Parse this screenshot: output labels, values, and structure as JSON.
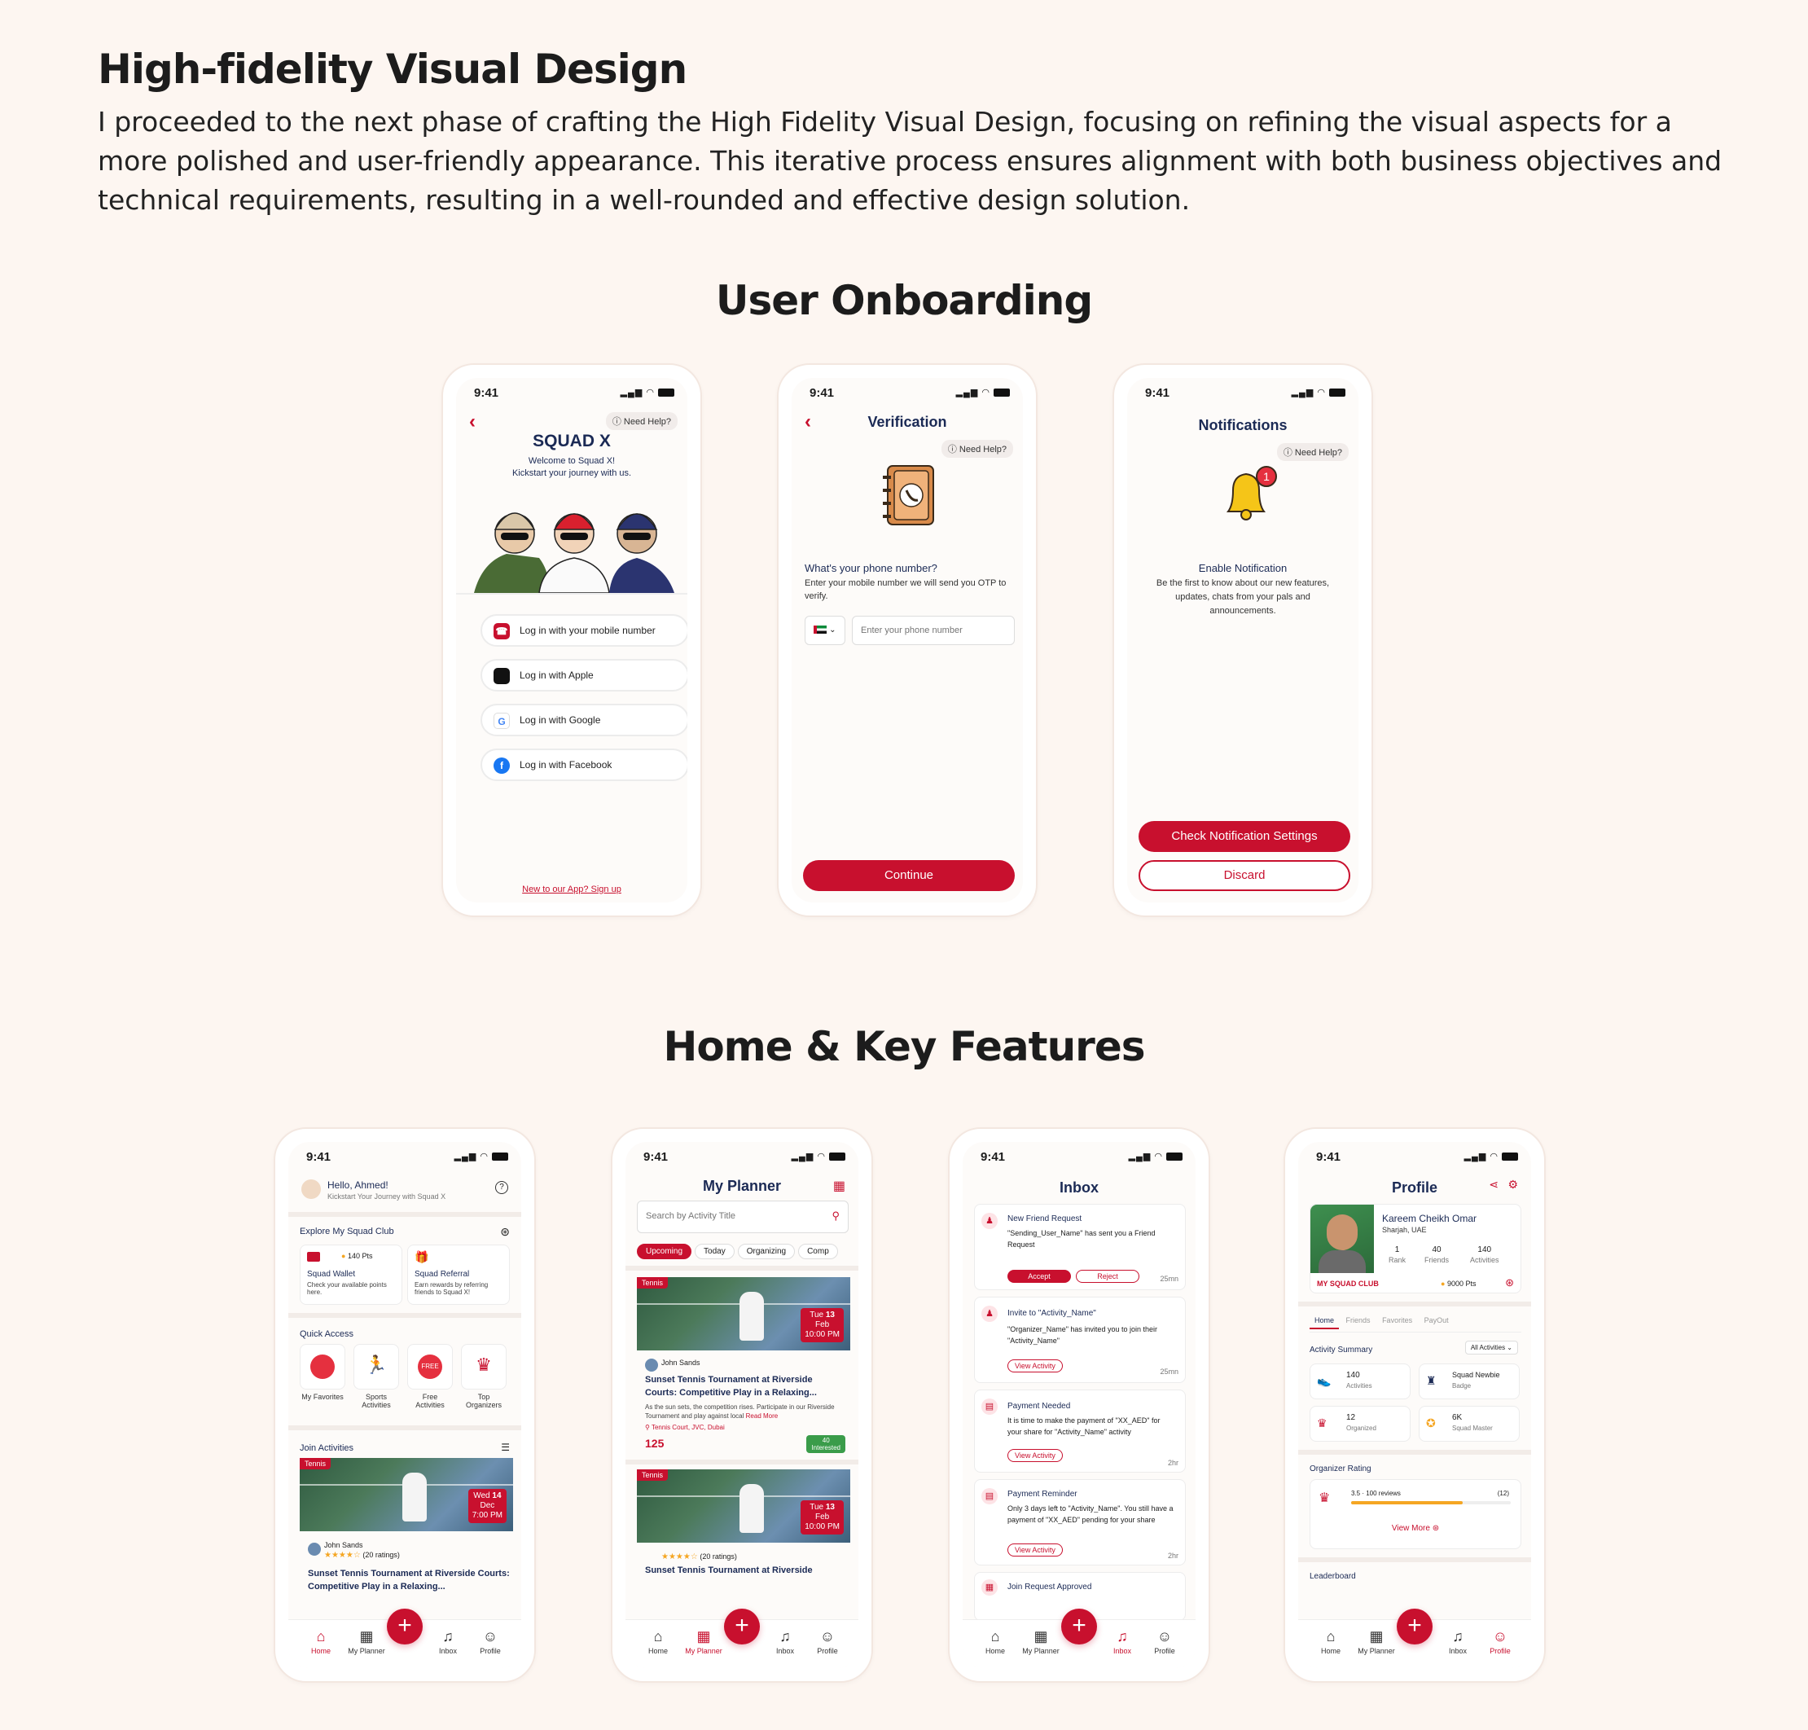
{
  "header": {
    "title": "High-fidelity Visual Design",
    "description": "I proceeded to the next phase of crafting the High Fidelity Visual Design, focusing on refining the visual aspects for a more polished and user-friendly appearance. This iterative process ensures alignment with both business objectives and technical requirements, resulting in a well-rounded and effective design solution."
  },
  "sections": {
    "onboarding": "User Onboarding",
    "home": "Home & Key Features"
  },
  "status_time": "9:41",
  "colors": {
    "brand": "#c8102e",
    "navy": "#1b2a55",
    "background": "#fdf6f1"
  },
  "common": {
    "need_help": "Need Help?"
  },
  "login": {
    "logo": "SQUAD X",
    "welcome": "Welcome to Squad X!",
    "subtitle": "Kickstart your journey with us.",
    "buttons": [
      "Log in with your mobile number",
      "Log in with Apple",
      "Log in with Google",
      "Log in with Facebook"
    ],
    "signup": "New to our App? Sign up"
  },
  "verification": {
    "title": "Verification",
    "question": "What's your phone number?",
    "hint": "Enter your mobile number we will send you OTP to verify.",
    "placeholder": "Enter your phone number",
    "continue": "Continue"
  },
  "notifications": {
    "title": "Notifications",
    "badge": "1",
    "heading": "Enable Notification",
    "body": "Be the first to know about our new features, updates, chats from your pals and announcements.",
    "primary": "Check Notification Settings",
    "secondary": "Discard"
  },
  "nav": [
    "Home",
    "My Planner",
    "Inbox",
    "Profile"
  ],
  "home": {
    "greeting": "Hello, Ahmed!",
    "sub": "Kickstart Your Journey with Squad X",
    "explore": "Explore My Squad Club",
    "wallet_pts": "140 Pts",
    "wallet_title": "Squad Wallet",
    "wallet_desc": "Check your available points here.",
    "referral_title": "Squad Referral",
    "referral_desc": "Earn rewards by referring friends to Squad X!",
    "quick_access": "Quick Access",
    "quick": [
      "My Favorites",
      "Sports Activities",
      "Free Activities",
      "Top Organizers"
    ],
    "join": "Join Activities",
    "tag": "Tennis",
    "date": [
      "Wed",
      "14",
      "Dec",
      "7:00 PM"
    ],
    "organizer": "John Sands",
    "ratings": "(20 ratings)",
    "event": "Sunset Tennis Tournament at Riverside Courts: Competitive Play in a Relaxing..."
  },
  "planner": {
    "title": "My Planner",
    "search": "Search by Activity Title",
    "tabs": [
      "Upcoming",
      "Today",
      "Organizing",
      "Comp"
    ],
    "date": [
      "Tue",
      "13",
      "Feb",
      "10:00 PM"
    ],
    "desc": "As the sun sets, the competition rises. Participate in our Riverside Tournament and play against local",
    "read_more": "Read More",
    "location": "Tennis Court, JVC, Dubai",
    "price": "125",
    "interested": "40",
    "interested_label": "Interested",
    "event2": "Sunset Tennis Tournament at Riverside"
  },
  "inbox": {
    "title": "Inbox",
    "items": [
      {
        "title": "New Friend Request",
        "body": "\"Sending_User_Name\" has sent you a Friend Request",
        "time": "25mn"
      },
      {
        "title": "Invite to \"Activity_Name\"",
        "body": "\"Organizer_Name\" has invited you to join their \"Activity_Name\"",
        "time": "25mn"
      },
      {
        "title": "Payment Needed",
        "body": "It is time to make the payment of \"XX_AED\" for your share for \"Activity_Name\" activity",
        "time": "2hr"
      },
      {
        "title": "Payment Reminder",
        "body": "Only 3 days left to \"Activity_Name\". You still have a payment of \"XX_AED\" pending for your share",
        "time": "2hr"
      },
      {
        "title": "Join Request Approved",
        "body": "",
        "time": ""
      }
    ],
    "accept": "Accept",
    "reject": "Reject",
    "view": "View Activity"
  },
  "profile": {
    "title": "Profile",
    "name": "Kareem Cheikh Omar",
    "location": "Sharjah, UAE",
    "stats": [
      [
        "1",
        "Rank"
      ],
      [
        "40",
        "Friends"
      ],
      [
        "140",
        "Activities"
      ]
    ],
    "club": "MY SQUAD CLUB",
    "club_pts": "9000 Pts",
    "tabs": [
      "Home",
      "Friends",
      "Favorites",
      "PayOut"
    ],
    "summary": "Activity Summary",
    "filter": "All Activities",
    "tiles": [
      [
        "140",
        "Activities"
      ],
      [
        "Squad Newbie",
        "Badge"
      ],
      [
        "12",
        "Organized"
      ],
      [
        "6K",
        "Squad Master"
      ]
    ],
    "rating_title": "Organizer Rating",
    "rating": "3.5 · 100 reviews",
    "rating_count": "(12)",
    "rating_value": 0.7,
    "view_more": "View More",
    "leaderboard": "Leaderboard"
  }
}
